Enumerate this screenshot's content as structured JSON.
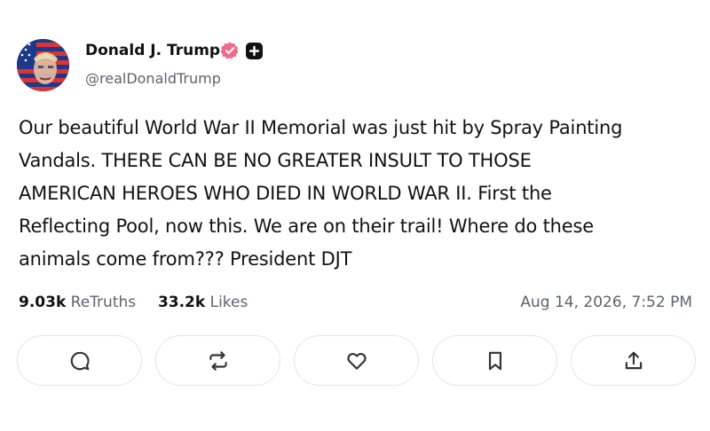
{
  "author": {
    "display_name": "Donald J. Trump",
    "handle": "@realDonaldTrump",
    "verified_icon": "verified-badge-icon",
    "badge_icon": "plus-badge-icon",
    "verified_color": "#f06a8a"
  },
  "post": {
    "lines": [
      "Our beautiful World War II Memorial was just hit by Spray Painting",
      "Vandals. THERE CAN BE NO GREATER INSULT TO THOSE",
      "AMERICAN HEROES WHO DIED IN WORLD WAR II. First the",
      "Reflecting Pool, now this. We are on their trail! Where do these",
      "animals come from??? President DJT"
    ]
  },
  "stats": {
    "retruths_count": "9.03k",
    "retruths_label": "ReTruths",
    "likes_count": "33.2k",
    "likes_label": "Likes",
    "timestamp": "Aug 14, 2026, 7:52 PM"
  },
  "actions": [
    {
      "icon": "reply-icon"
    },
    {
      "icon": "retruth-icon"
    },
    {
      "icon": "like-icon"
    },
    {
      "icon": "bookmark-icon"
    },
    {
      "icon": "share-icon"
    }
  ]
}
